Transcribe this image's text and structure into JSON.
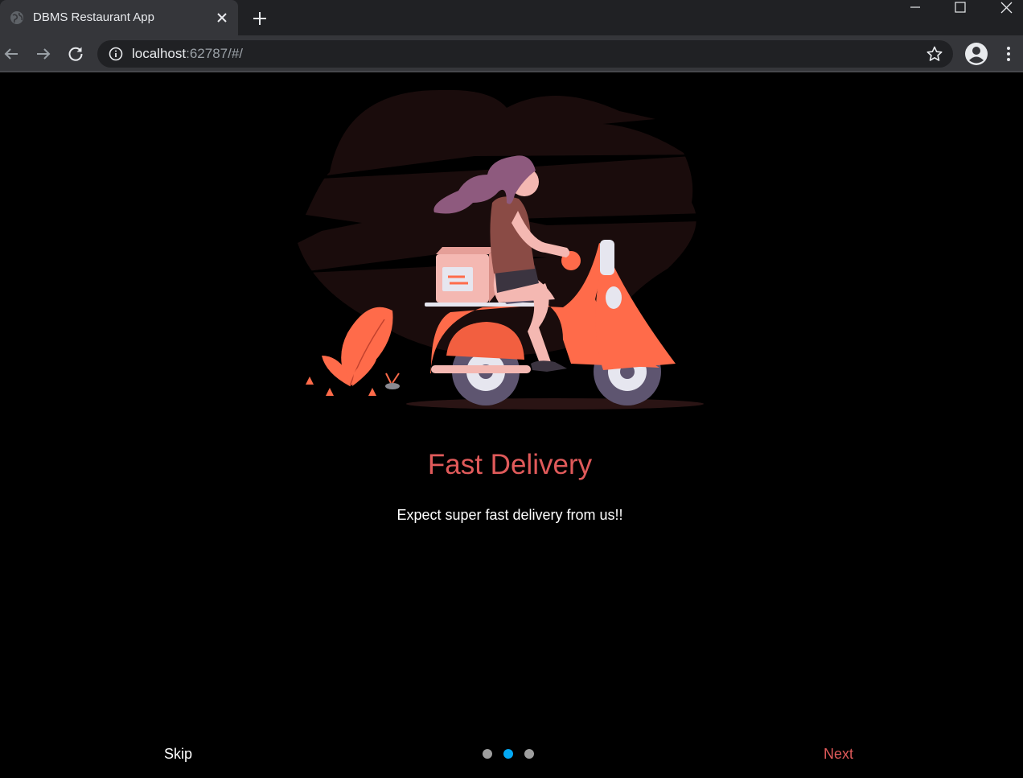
{
  "browser": {
    "tab_title": "DBMS Restaurant App",
    "url_host": "localhost",
    "url_rest": ":62787/#/"
  },
  "onboarding": {
    "title": "Fast Delivery",
    "subtitle": "Expect super fast delivery from us!!",
    "skip_label": "Skip",
    "next_label": "Next",
    "pages_total": 3,
    "current_page": 2
  },
  "colors": {
    "accent": "#e05a5a",
    "active_dot": "#03a9f4",
    "inactive_dot": "#9e9e9e",
    "scooter": "#ff6b4a"
  },
  "icons": [
    "globe-icon",
    "close-icon",
    "plus-icon",
    "minimize-icon",
    "maximize-icon",
    "back-arrow-icon",
    "forward-arrow-icon",
    "reload-icon",
    "info-icon",
    "star-icon",
    "profile-icon",
    "kebab-menu-icon"
  ]
}
